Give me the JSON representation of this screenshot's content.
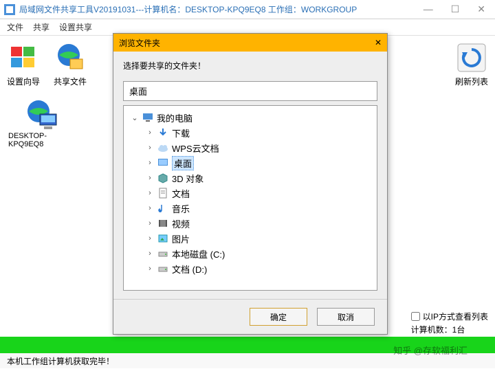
{
  "window": {
    "title": "局域网文件共享工具V20191031---计算机名：DESKTOP-KPQ9EQ8 工作组：WORKGROUP"
  },
  "menu": {
    "file": "文件",
    "share": "共享",
    "set_share": "设置共享"
  },
  "toolbar": {
    "wizard": "设置向导",
    "share_file": "共享文件",
    "refresh": "刷新列表"
  },
  "desktop": {
    "computer_name": "DESKTOP-KPQ9EQ8"
  },
  "dialog": {
    "title": "浏览文件夹",
    "close": "✕",
    "prompt": "选择要共享的文件夹！",
    "path": "桌面",
    "tree": {
      "root": "我的电脑",
      "downloads": "下载",
      "wps": "WPS云文档",
      "desktop": "桌面",
      "objects3d": "3D 对象",
      "documents": "文档",
      "music": "音乐",
      "videos": "视频",
      "pictures": "图片",
      "disk_c": "本地磁盘 (C:)",
      "disk_d": "文档 (D:)"
    },
    "ok": "确定",
    "cancel": "取消"
  },
  "bottom": {
    "ip_mode": "以IP方式查看列表",
    "count_label": "计算机数：1台"
  },
  "status": {
    "text": "本机工作组计算机获取完毕！"
  },
  "watermark": "知乎 @存软福利汇"
}
